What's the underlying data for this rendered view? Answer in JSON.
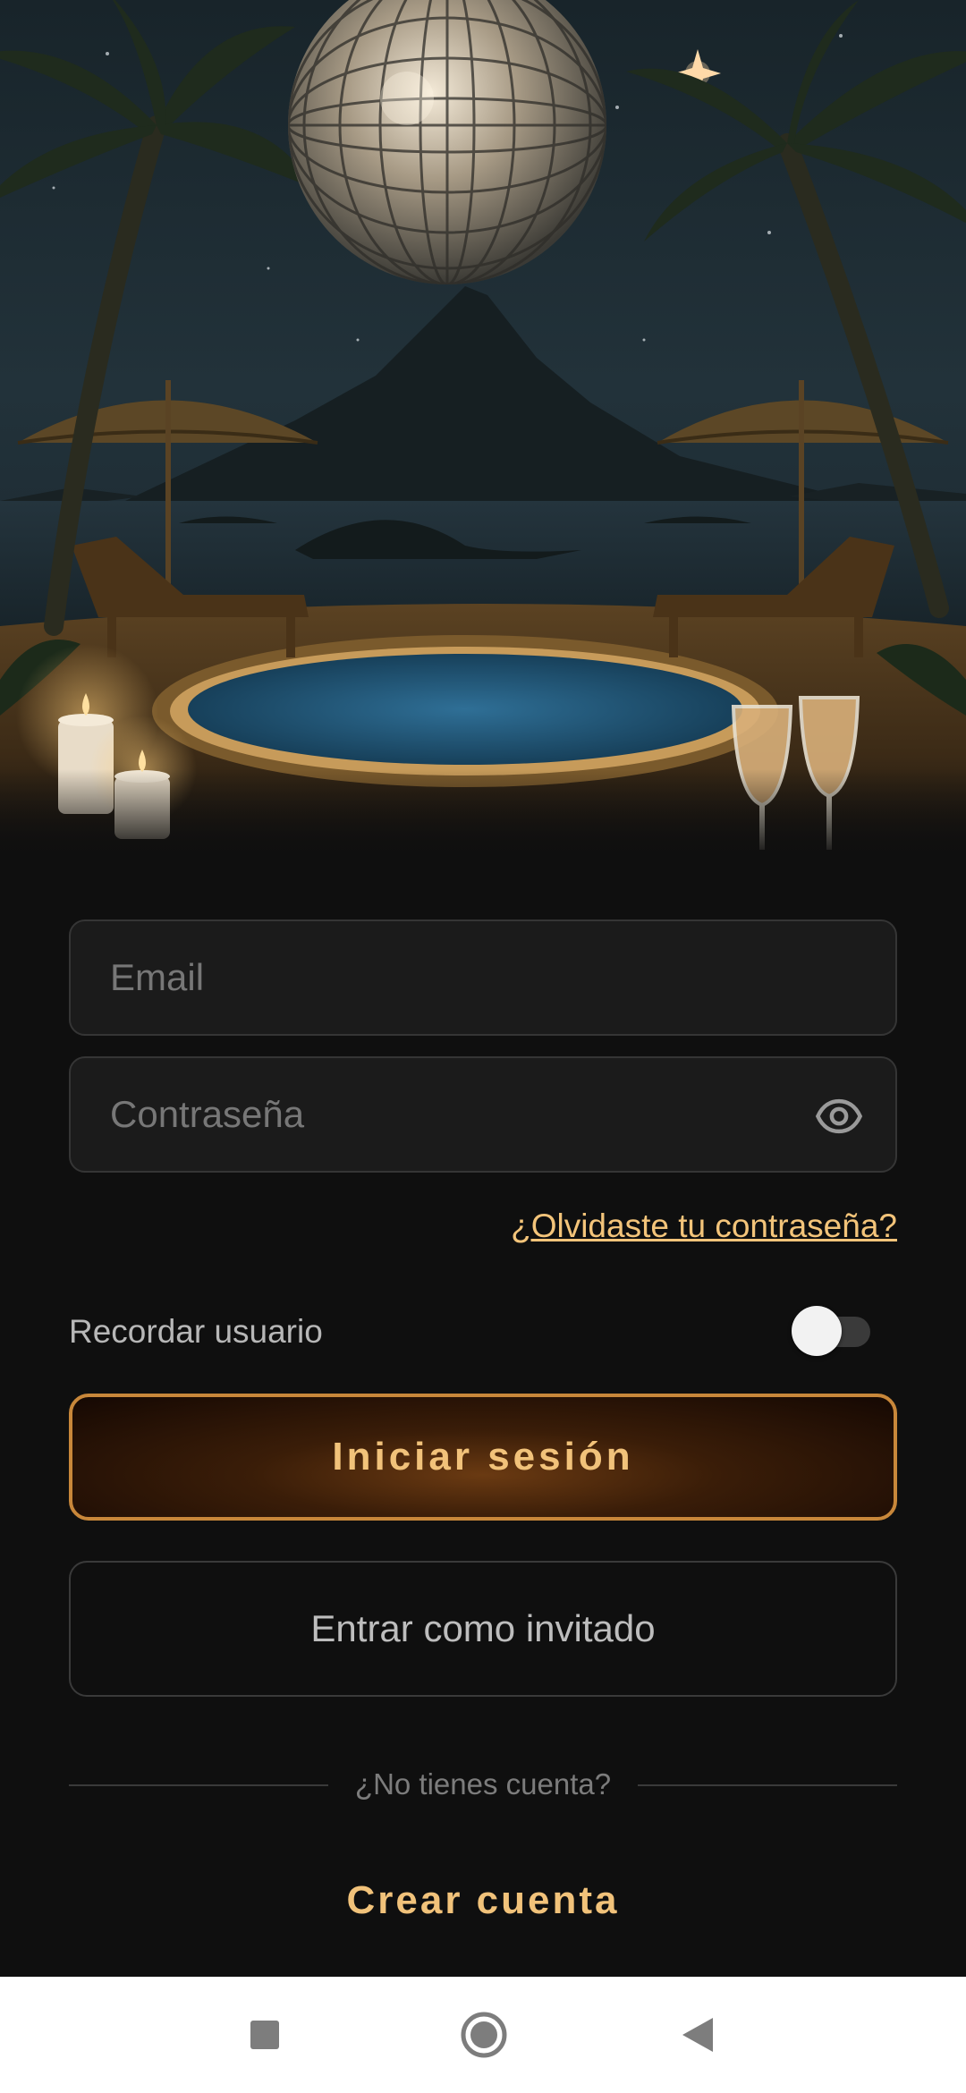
{
  "login": {
    "email_placeholder": "Email",
    "password_placeholder": "Contraseña",
    "forgot_password": "¿Olvidaste tu contraseña?",
    "remember_label": "Recordar usuario",
    "remember_enabled": false,
    "login_button": "Iniciar sesión",
    "guest_button": "Entrar como invitado",
    "no_account": "¿No tienes cuenta?",
    "create_account": "Crear cuenta"
  },
  "icons": {
    "password_visibility": "eye-icon",
    "nav_recents": "square-icon",
    "nav_home": "circle-icon",
    "nav_back": "triangle-back-icon"
  },
  "colors": {
    "background": "#0f0f0f",
    "accent_gold": "#f1c27a",
    "button_border": "#c8873a",
    "field_bg": "#1b1b1b"
  }
}
